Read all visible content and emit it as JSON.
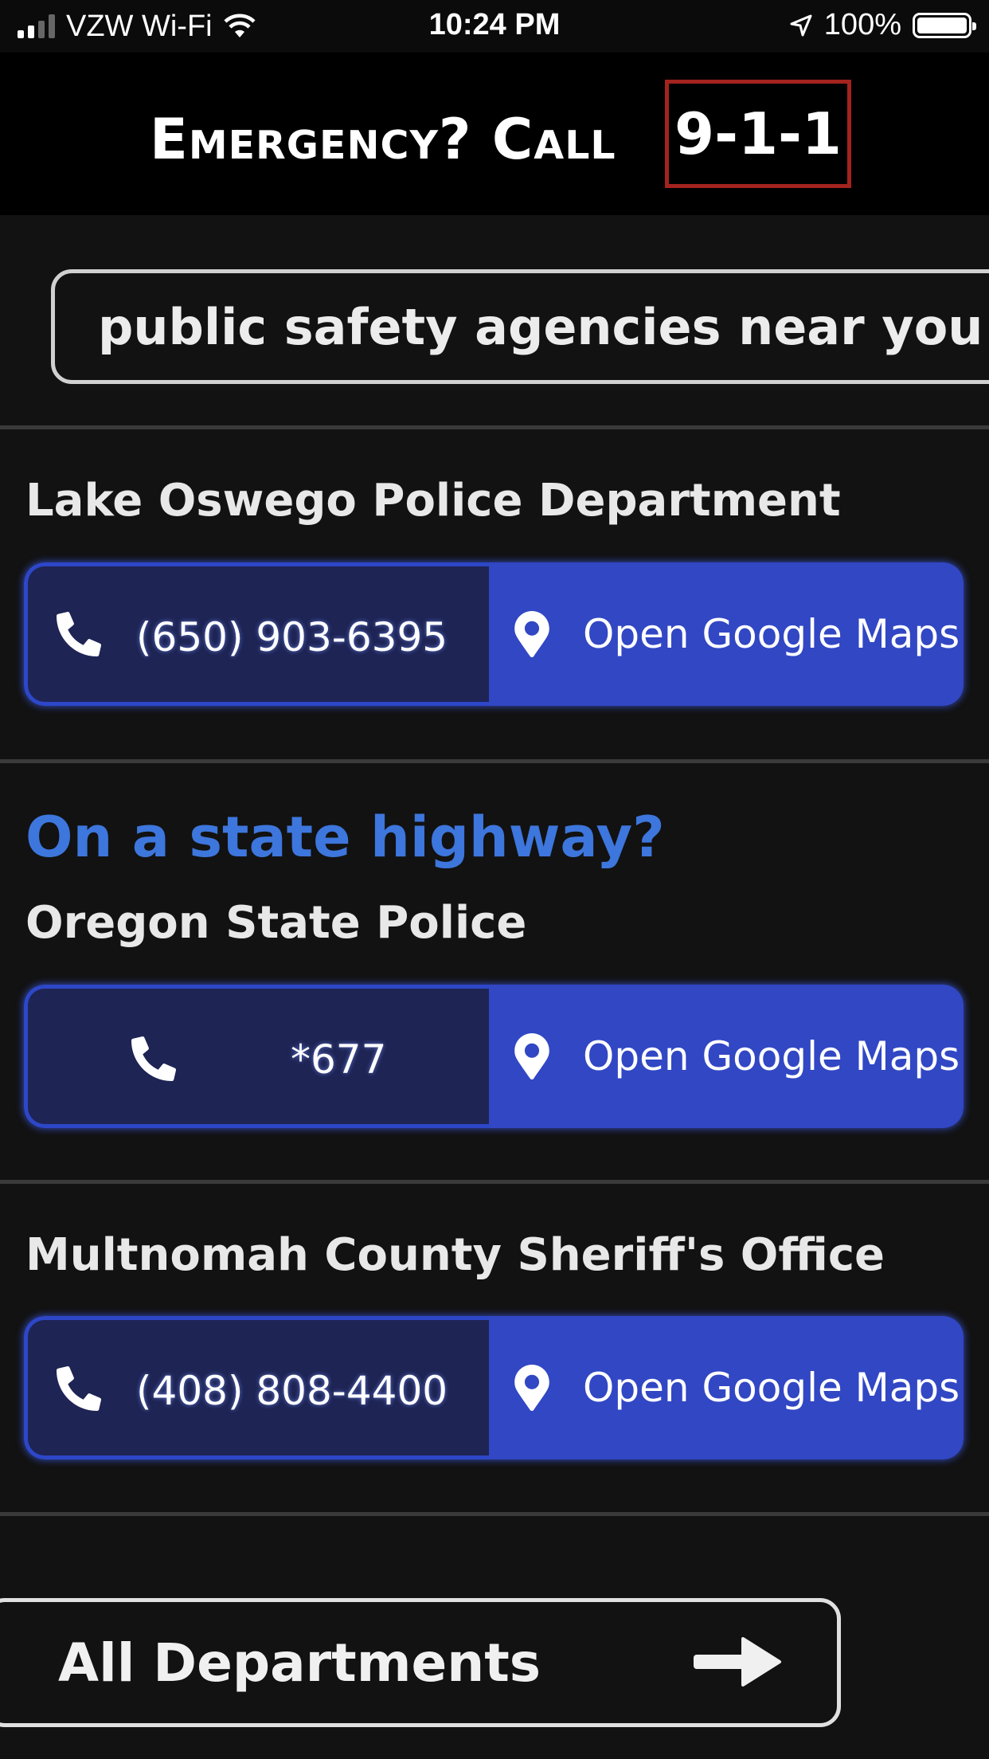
{
  "status_bar": {
    "carrier": "VZW Wi-Fi",
    "time": "10:24 PM",
    "battery": "100%"
  },
  "header": {
    "emergency_text": "Emergency? Call",
    "emergency_number": "9-1-1"
  },
  "search": {
    "text": "public safety agencies near you"
  },
  "agencies": [
    {
      "name": "Lake Oswego Police Department",
      "phone": "(650) 903-6395",
      "maps_label": "Open Google Maps"
    },
    {
      "section_heading": "On a state highway?",
      "name": "Oregon State Police",
      "phone": "*677",
      "maps_label": "Open Google Maps"
    },
    {
      "name": "Multnomah County Sheriff's Office",
      "phone": "(408) 808-4400",
      "maps_label": "Open Google Maps"
    }
  ],
  "footer": {
    "all_departments_label": "All Departments"
  },
  "colors": {
    "background": "#121212",
    "header_bg": "#000000",
    "emergency_border": "#a3231f",
    "highway_heading": "#3d76dc",
    "phone_button_bg": "#1e2454",
    "maps_button_bg": "#3147c4"
  },
  "icons": [
    "signal-icon",
    "wifi-icon",
    "location-arrow-icon",
    "battery-icon",
    "phone-icon",
    "map-pin-icon",
    "arrow-right-icon"
  ]
}
